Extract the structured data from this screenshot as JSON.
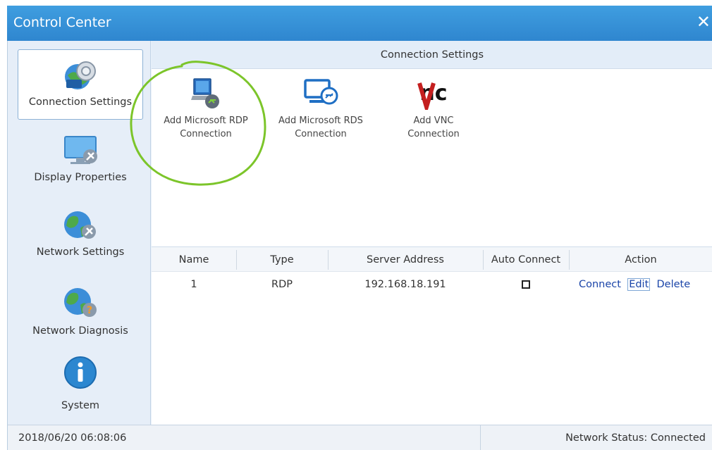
{
  "window": {
    "title": "Control Center",
    "close_glyph": "✕"
  },
  "sidebar": {
    "items": [
      {
        "label": "Connection Settings",
        "icon": "connection-settings-icon",
        "active": true
      },
      {
        "label": "Display Properties",
        "icon": "display-properties-icon",
        "active": false
      },
      {
        "label": "Network Settings",
        "icon": "network-settings-icon",
        "active": false
      },
      {
        "label": "Network Diagnosis",
        "icon": "network-diagnosis-icon",
        "active": false
      },
      {
        "label": "System",
        "icon": "system-info-icon",
        "active": false
      }
    ]
  },
  "main": {
    "header": "Connection Settings",
    "add_options": [
      {
        "line1": "Add Microsoft RDP",
        "line2": "Connection",
        "icon": "rdp-icon"
      },
      {
        "line1": "Add Microsoft RDS",
        "line2": "Connection",
        "icon": "rds-icon"
      },
      {
        "line1": "Add VNC",
        "line2": "Connection",
        "icon": "vnc-icon"
      }
    ],
    "table": {
      "columns": [
        "Name",
        "Type",
        "Server Address",
        "Auto Connect",
        "Action"
      ],
      "rows": [
        {
          "name": "1",
          "type": "RDP",
          "server_address": "192.168.18.191",
          "auto_connect": false,
          "actions": [
            "Connect",
            "Edit",
            "Delete"
          ]
        }
      ]
    }
  },
  "status_bar": {
    "datetime": "2018/06/20 06:08:06",
    "network_status": "Network Status: Connected"
  },
  "colors": {
    "titlebar": "#2f86cf",
    "link": "#1a44a8",
    "annotation": "#7cc52a"
  }
}
